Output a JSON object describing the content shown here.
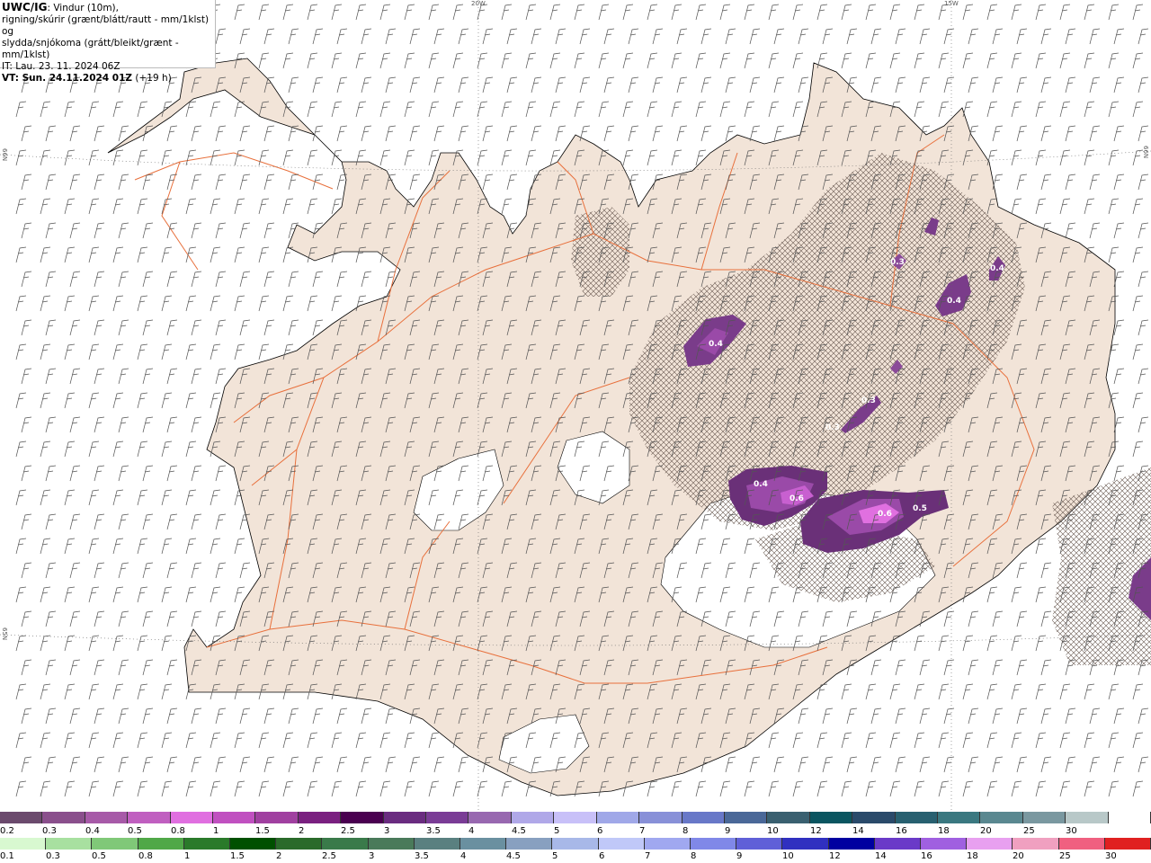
{
  "info": {
    "title_bold": "UWC/IG",
    "title_rest": ": Vindur (10m),",
    "line2": "rigning/skúrir (grænt/blátt/rautt - mm/1klst) og",
    "line3": "slydda/snjókoma (grátt/bleikt/grænt - mm/1klst)",
    "line4": "IT: Lau. 23. 11. 2024 06Z",
    "line5_bold": "VT: Sun. 24.11.2024 01Z",
    "line5_rest": " (+19 h)"
  },
  "graticule": {
    "lon_20w": "20W",
    "lon_15w": "15W",
    "lat_66_left": "66N",
    "lat_66_right": "66N",
    "lat_65_left": "65N"
  },
  "contour_labels": [
    "0.4",
    "0.4",
    "0.3",
    "0.4",
    "0.3",
    "0.3",
    "0.4",
    "0.6",
    "0.6",
    "0.5"
  ],
  "legend_snow": {
    "labels": [
      "0.2",
      "0.3",
      "0.4",
      "0.5",
      "0.8",
      "1",
      "1.5",
      "2",
      "2.5",
      "3",
      "3.5",
      "4",
      "4.5",
      "5",
      "6",
      "7",
      "8",
      "9",
      "10",
      "12",
      "14",
      "16",
      "18",
      "20",
      "25",
      "30"
    ],
    "colors": [
      "#6b4a6d",
      "#8a4f8c",
      "#a75aa8",
      "#c05fc0",
      "#e06fe0",
      "#c050c0",
      "#a040a0",
      "#7a2080",
      "#4a0050",
      "#6a2c80",
      "#7a3c96",
      "#9868b0",
      "#b0a8e8",
      "#c8c0f8",
      "#a0a8e8",
      "#8890d8",
      "#6878c8",
      "#4a6898",
      "#3a6070",
      "#0a5560",
      "#2a4a6a",
      "#286070",
      "#3a7880",
      "#5a8890",
      "#7a98a0",
      "#b8c8c8",
      "#ffffff"
    ]
  },
  "legend_rain": {
    "labels": [
      "0.1",
      "0.3",
      "0.5",
      "0.8",
      "1",
      "1.5",
      "2",
      "2.5",
      "3",
      "3.5",
      "4",
      "4.5",
      "5",
      "6",
      "7",
      "8",
      "9",
      "10",
      "12",
      "14",
      "16",
      "18",
      "20",
      "25",
      "30"
    ],
    "colors": [
      "#d8f8d0",
      "#a8e0a0",
      "#80c878",
      "#50a848",
      "#2a7a2a",
      "#005000",
      "#2a6a2a",
      "#3a7a4a",
      "#4a7a5a",
      "#5a8080",
      "#6a90a0",
      "#88a0c0",
      "#a8b8e8",
      "#c0c8f8",
      "#a0a8f0",
      "#8088e8",
      "#6060d8",
      "#3030c0",
      "#0000a0",
      "#6a3ac8",
      "#a060e0",
      "#e8a0f0",
      "#f0a0c0",
      "#f06080",
      "#e02020"
    ]
  }
}
